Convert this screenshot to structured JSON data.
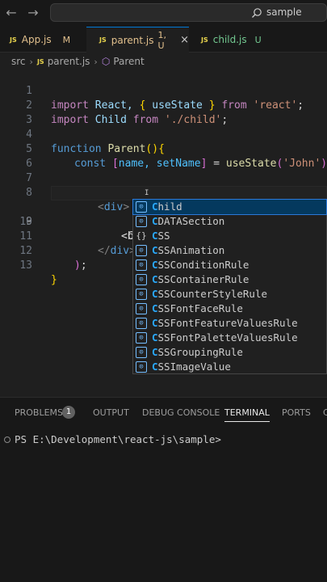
{
  "titlebar": {
    "back_icon": "arrow-left",
    "forward_icon": "arrow-right",
    "search_text": "sample"
  },
  "tabs": [
    {
      "label": "App.js",
      "status": "M",
      "icon_text": "JS"
    },
    {
      "label": "parent.js",
      "status": "1, U",
      "icon_text": "JS",
      "close": "×"
    },
    {
      "label": "child.js",
      "status": "U",
      "icon_text": "JS"
    }
  ],
  "breadcrumb": {
    "folder": "src",
    "file": "parent.js",
    "file_icon_text": "JS",
    "symbol": "Parent"
  },
  "editor": {
    "line_numbers": [
      "1",
      "2",
      "3",
      "4",
      "5",
      "6",
      "7",
      "8",
      "9",
      "10",
      "11",
      "12",
      "13"
    ],
    "current_line": "9",
    "lines": {
      "l1": {
        "import": "import",
        "open": "{",
        "react": "React,",
        "usestate": "useState",
        "close": "}",
        "from": "from",
        "src": "'react'",
        "semi": ";"
      },
      "l2": {
        "import": "import",
        "child": "Child",
        "from": "from",
        "src": "'./child'",
        "semi": ";"
      },
      "l4": {
        "function": "function",
        "name": "Parent",
        "parens": "()",
        "brace": "{"
      },
      "l5": {
        "const": "const",
        "ob": "[",
        "name": "name,",
        "setname": "setName",
        "cb": "]",
        "eq": "=",
        "fn": "useState",
        "op": "(",
        "arg": "'John'",
        "cp": ")",
        "semi": ";"
      },
      "l7": {
        "return": "return",
        "paren": "("
      },
      "l8": {
        "lt": "<",
        "tag": "div",
        "gt": ">"
      },
      "l9": {
        "lt": "<",
        "typed": "C"
      },
      "l10": {
        "text": "<b"
      },
      "l11": {
        "lt": "</",
        "tag": "div",
        "gt": ">"
      },
      "l12": {
        "paren": ")",
        "semi": ";"
      },
      "l13": {
        "brace": "}"
      }
    }
  },
  "suggestions": [
    {
      "match": "C",
      "rest": "hild",
      "icon": "symbol-variable",
      "icon_text": "[⊙]"
    },
    {
      "match": "C",
      "rest": "DATASection",
      "icon": "symbol-variable",
      "icon_text": "[⊙]"
    },
    {
      "match": "C",
      "rest": "SS",
      "icon": "braces",
      "icon_text": "{}"
    },
    {
      "match": "C",
      "rest": "SSAnimation",
      "icon": "symbol-variable",
      "icon_text": "[⊙]"
    },
    {
      "match": "C",
      "rest": "SSConditionRule",
      "icon": "symbol-variable",
      "icon_text": "[⊙]"
    },
    {
      "match": "C",
      "rest": "SSContainerRule",
      "icon": "symbol-variable",
      "icon_text": "[⊙]"
    },
    {
      "match": "C",
      "rest": "SSCounterStyleRule",
      "icon": "symbol-variable",
      "icon_text": "[⊙]"
    },
    {
      "match": "C",
      "rest": "SSFontFaceRule",
      "icon": "symbol-variable",
      "icon_text": "[⊙]"
    },
    {
      "match": "C",
      "rest": "SSFontFeatureValuesRule",
      "icon": "symbol-variable",
      "icon_text": "[⊙]"
    },
    {
      "match": "C",
      "rest": "SSFontPaletteValuesRule",
      "icon": "symbol-variable",
      "icon_text": "[⊙]"
    },
    {
      "match": "C",
      "rest": "SSGroupingRule",
      "icon": "symbol-variable",
      "icon_text": "[⊙]"
    },
    {
      "match": "C",
      "rest": "SSImageValue",
      "icon": "symbol-variable",
      "icon_text": "[⊙]"
    }
  ],
  "panel": {
    "tabs": {
      "problems": "PROBLEMS",
      "problems_count": "1",
      "output": "OUTPUT",
      "debug": "DEBUG CONSOLE",
      "terminal": "TERMINAL",
      "ports": "PORTS",
      "more": "C"
    },
    "terminal_prompt": "PS E:\\Development\\react-js\\sample>"
  },
  "colors": {
    "accent": "#0078d4",
    "keyword": "#c586c0",
    "string": "#ce9178",
    "function": "#dcdcaa",
    "variable": "#9cdcfe",
    "untracked": "#73c991",
    "modified": "#e2c08d"
  }
}
